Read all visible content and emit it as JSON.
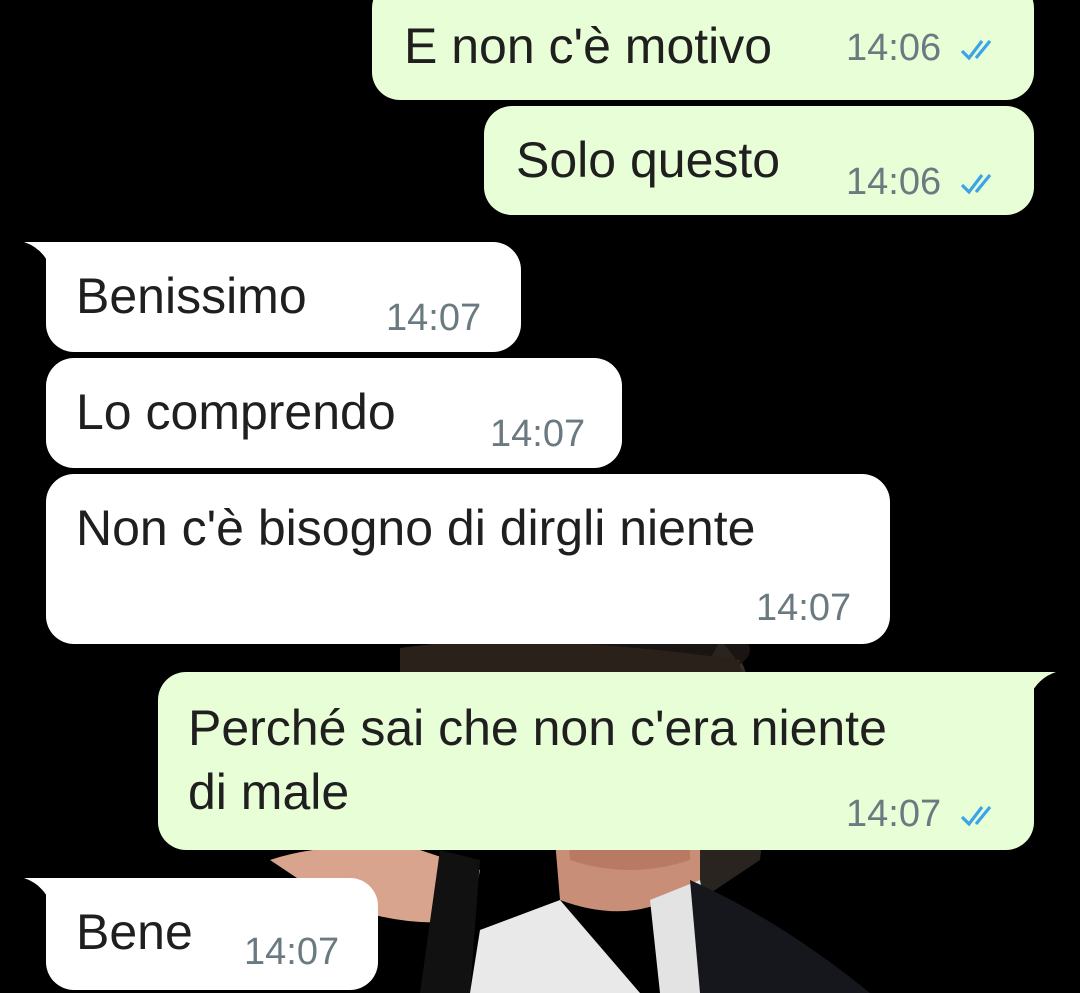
{
  "wallpaper": {
    "description_icon": "photo-wallpaper"
  },
  "colors": {
    "outgoing_bubble": "#e7fed6",
    "incoming_bubble": "#ffffff",
    "read_tick": "#3aa5e6",
    "timestamp": "#6b7a80",
    "background": "#000000"
  },
  "messages": [
    {
      "direction": "outgoing",
      "text": "E non c'è motivo",
      "time": "14:06",
      "status": "read"
    },
    {
      "direction": "outgoing",
      "text": "Solo questo",
      "time": "14:06",
      "status": "read"
    },
    {
      "direction": "incoming",
      "text": "Benissimo",
      "time": "14:07"
    },
    {
      "direction": "incoming",
      "text": "Lo comprendo",
      "time": "14:07"
    },
    {
      "direction": "incoming",
      "text": "Non c'è bisogno di dirgli niente",
      "time": "14:07"
    },
    {
      "direction": "outgoing",
      "text_line1": "Perché sai che non c'era niente",
      "text_line2": "di male",
      "time": "14:07",
      "status": "read"
    },
    {
      "direction": "incoming",
      "text": "Bene",
      "time": "14:07"
    }
  ]
}
